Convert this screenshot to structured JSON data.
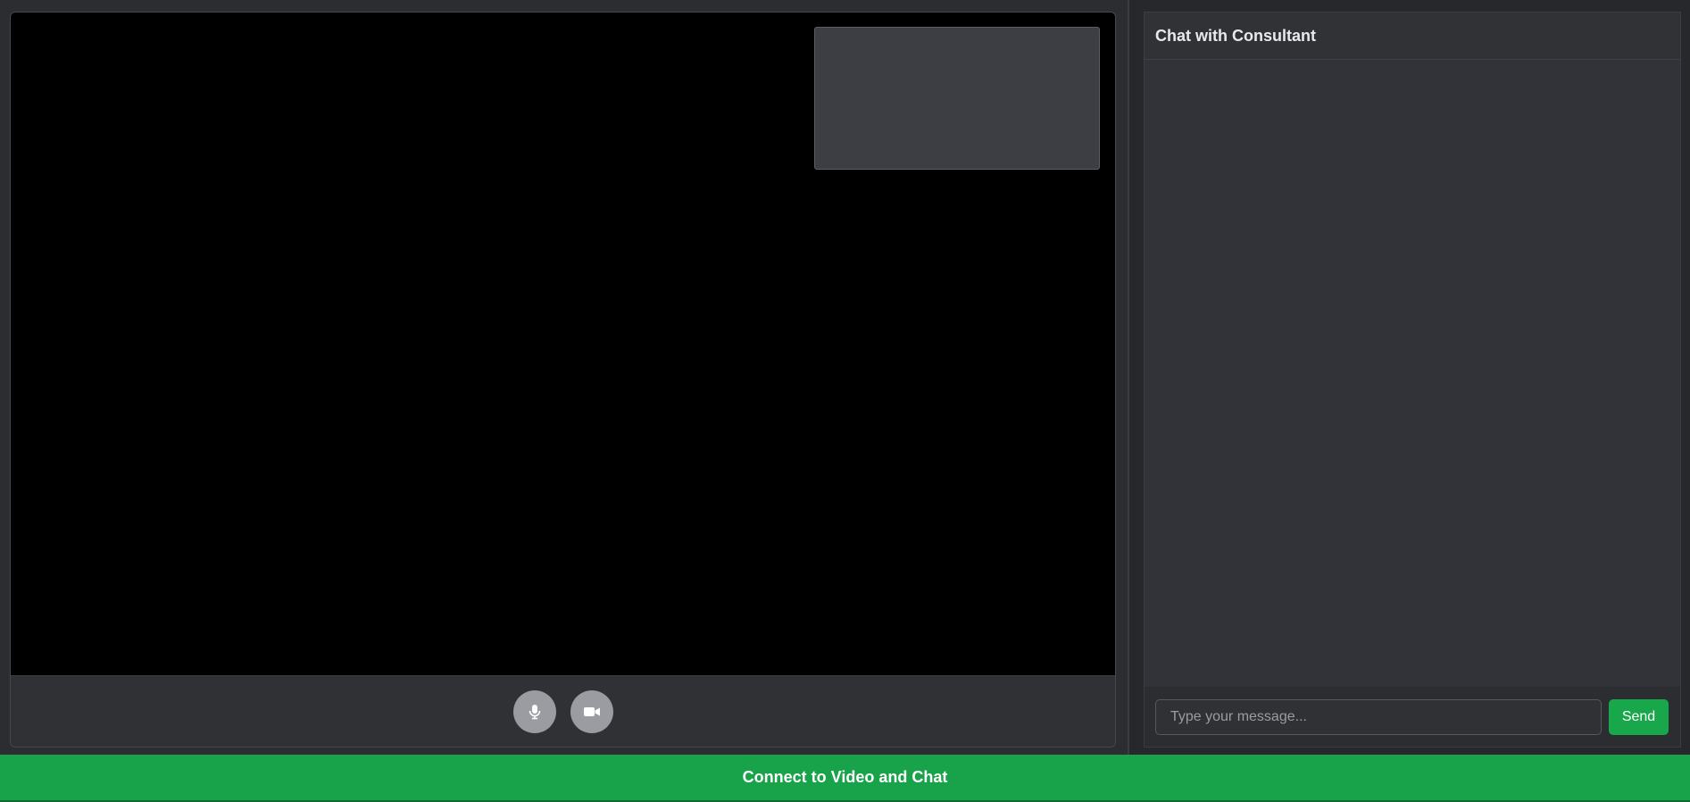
{
  "video": {
    "remote_video": "",
    "local_video": "",
    "controls": {
      "mic_icon": "microphone-icon",
      "camera_icon": "video-camera-icon"
    }
  },
  "chat": {
    "title": "Chat with Consultant",
    "input": {
      "value": "",
      "placeholder": "Type your message..."
    },
    "send_label": "Send"
  },
  "footer": {
    "connect_label": "Connect to Video and Chat"
  },
  "colors": {
    "accent": "#18a34a",
    "background": "#26282c",
    "panel": "#313338",
    "video_bg": "#000000",
    "control_button": "#9a9ca2"
  }
}
